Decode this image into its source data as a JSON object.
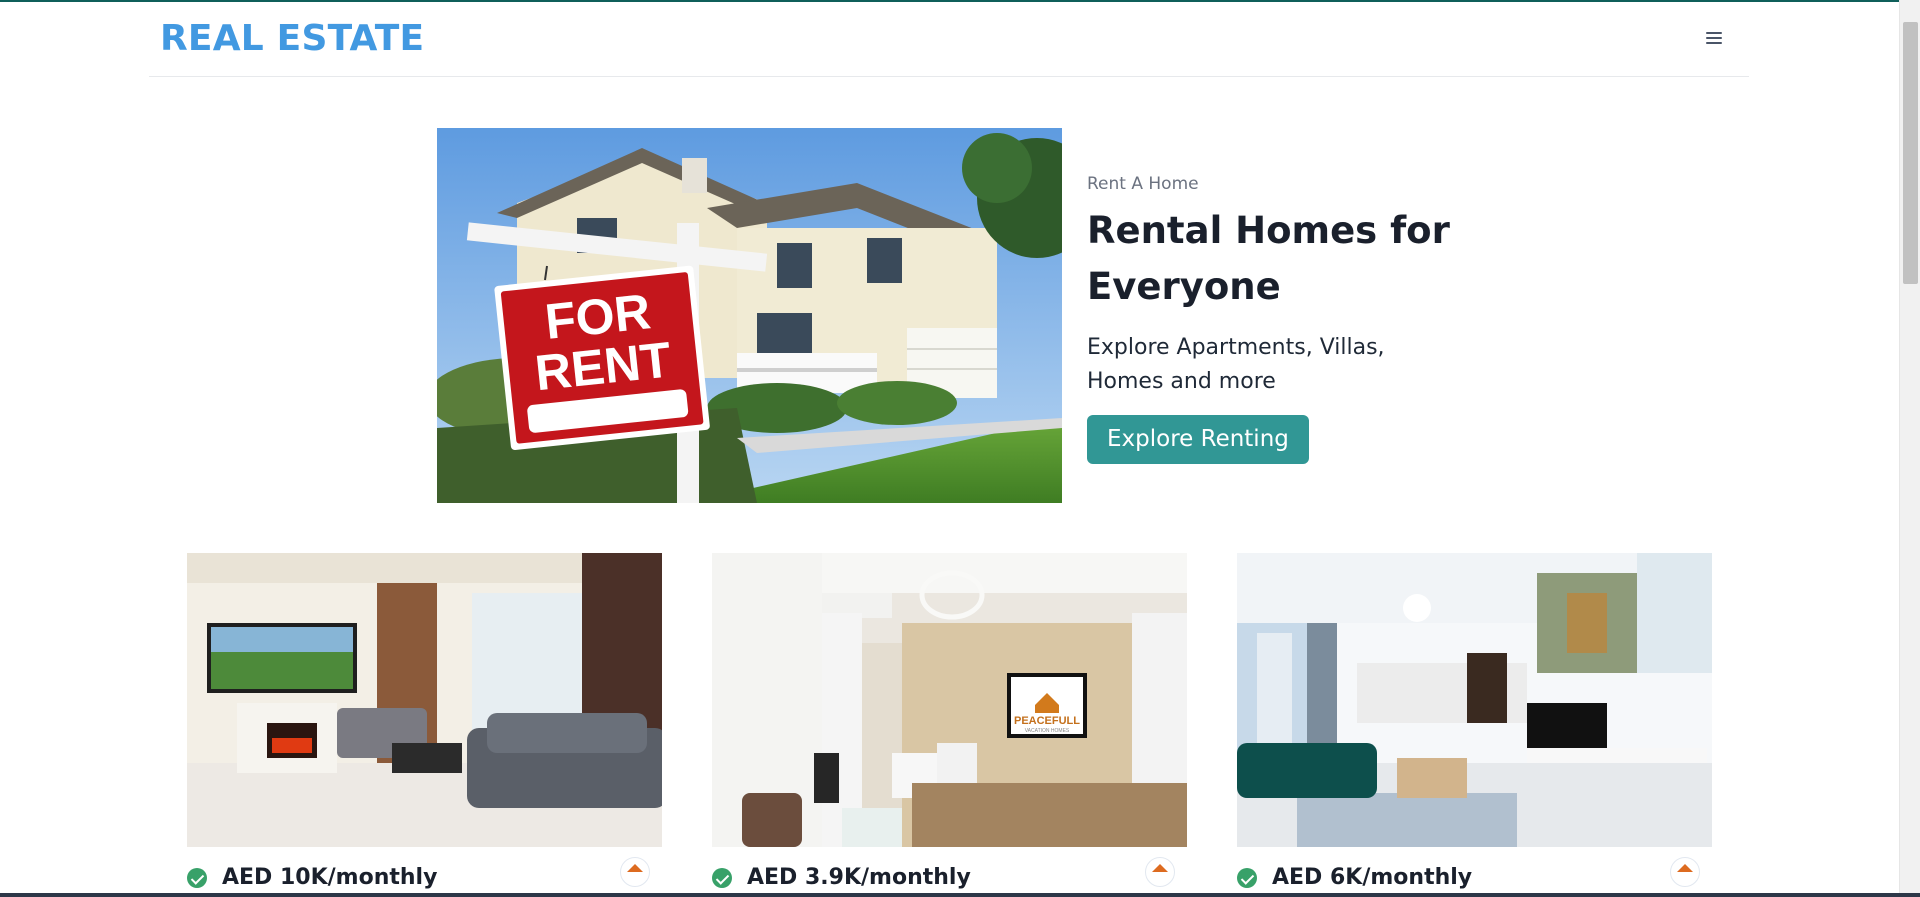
{
  "header": {
    "brand": "REAL ESTATE"
  },
  "hero": {
    "eyebrow": "Rent A Home",
    "title_line1": "Rental Homes for",
    "title_line2": "Everyone",
    "subtitle": "Explore Apartments, Villas, Homes and more",
    "cta_label": "Explore Renting",
    "image_sign_line1": "FOR",
    "image_sign_line2": "RENT"
  },
  "listings": [
    {
      "price": "AED 10K/monthly"
    },
    {
      "price": "AED 3.9K/monthly",
      "image_brand": "PEACEFULL",
      "image_tagline": "VACATION HOMES"
    },
    {
      "price": "AED 6K/monthly"
    }
  ],
  "colors": {
    "brand": "#4299e1",
    "cta": "#319795",
    "check": "#38a169"
  }
}
